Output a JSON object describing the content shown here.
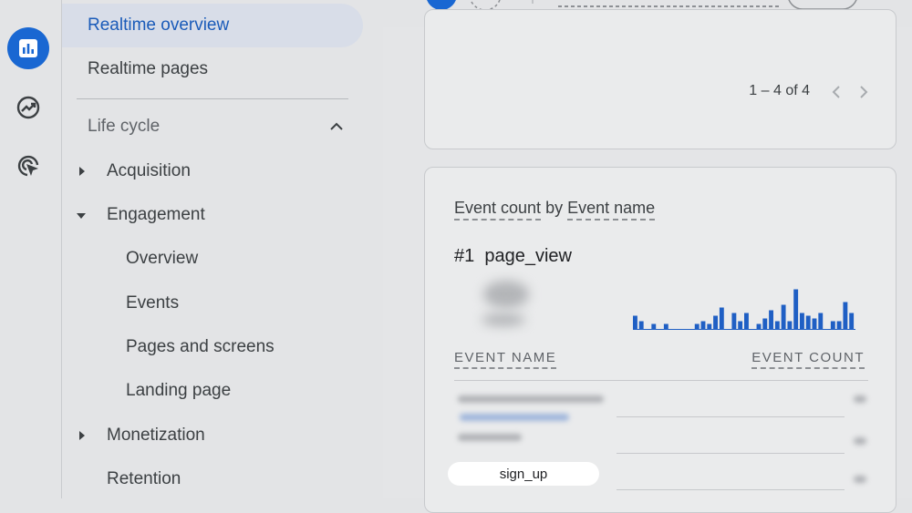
{
  "nav": {
    "realtime_overview": "Realtime overview",
    "realtime_pages": "Realtime pages",
    "life_cycle": "Life cycle",
    "acquisition": "Acquisition",
    "engagement": "Engagement",
    "overview": "Overview",
    "events": "Events",
    "pages_and_screens": "Pages and screens",
    "landing_page": "Landing page",
    "monetization": "Monetization",
    "retention": "Retention"
  },
  "table_card": {
    "pagination": "1 – 4 of 4"
  },
  "event_card": {
    "title_metric": "Event count",
    "title_by": "by",
    "title_dimension": "Event name",
    "top_rank": "#1",
    "top_event": "page_view",
    "col_event_name": "EVENT NAME",
    "col_event_count": "EVENT COUNT",
    "sparkline": [
      5,
      3,
      0,
      2,
      0,
      2,
      0,
      0,
      0,
      0,
      2,
      3,
      2,
      5,
      8,
      0,
      6,
      3,
      6,
      0,
      2,
      4,
      7,
      3,
      9,
      3,
      12,
      6,
      5,
      4,
      6,
      0,
      3,
      3,
      10,
      6
    ],
    "sparkline_active_bar": 26
  },
  "tooltip": {
    "label": "sign_up"
  },
  "colors": {
    "accent": "#1967d2",
    "selected_text": "#1a5bb9",
    "bar": "#1f5fc4"
  }
}
